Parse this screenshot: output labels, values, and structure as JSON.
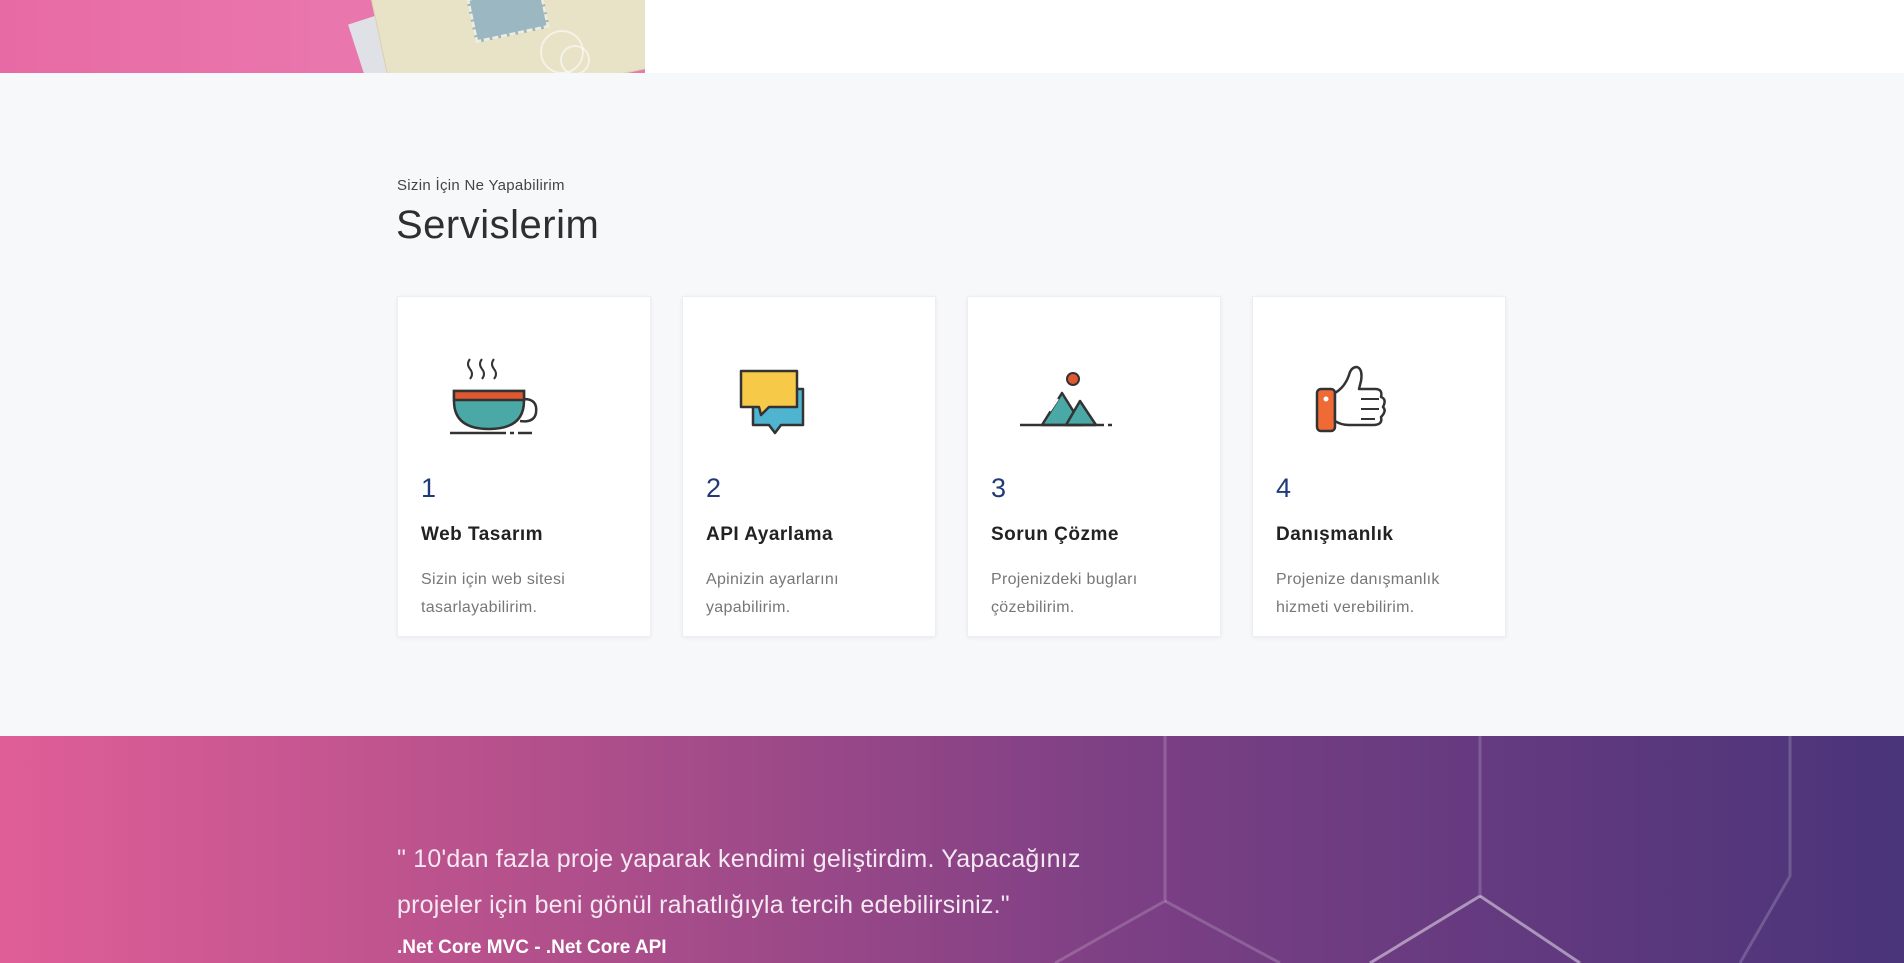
{
  "services": {
    "subtitle": "Sizin İçin Ne Yapabilirim",
    "title": "Servislerim",
    "items": [
      {
        "number": "1",
        "name": "Web Tasarım",
        "description": "Sizin için web sitesi tasarlayabilirim.",
        "icon": "coffee-cup-icon"
      },
      {
        "number": "2",
        "name": "API Ayarlama",
        "description": "Apinizin ayarlarını yapabilirim.",
        "icon": "chat-bubbles-icon"
      },
      {
        "number": "3",
        "name": "Sorun Çözme",
        "description": "Projenizdeki bugları çözebilirim.",
        "icon": "mountains-icon"
      },
      {
        "number": "4",
        "name": "Danışmanlık",
        "description": "Projenize danışmanlık hizmeti verebilirim.",
        "icon": "thumbs-up-icon"
      }
    ]
  },
  "testimonial": {
    "quote": "\" 10'dan fazla proje yaparak kendimi geliştirdim. Yapacağınız projeler için beni gönül rahatlığıyla tercih edebilirsiniz.\"",
    "tech": ".Net Core MVC - .Net Core API"
  },
  "colors": {
    "accent_number": "#1e3a78",
    "section_bg": "#f7f8fa",
    "gradient_start": "#e05e97",
    "gradient_end": "#4a347a"
  }
}
